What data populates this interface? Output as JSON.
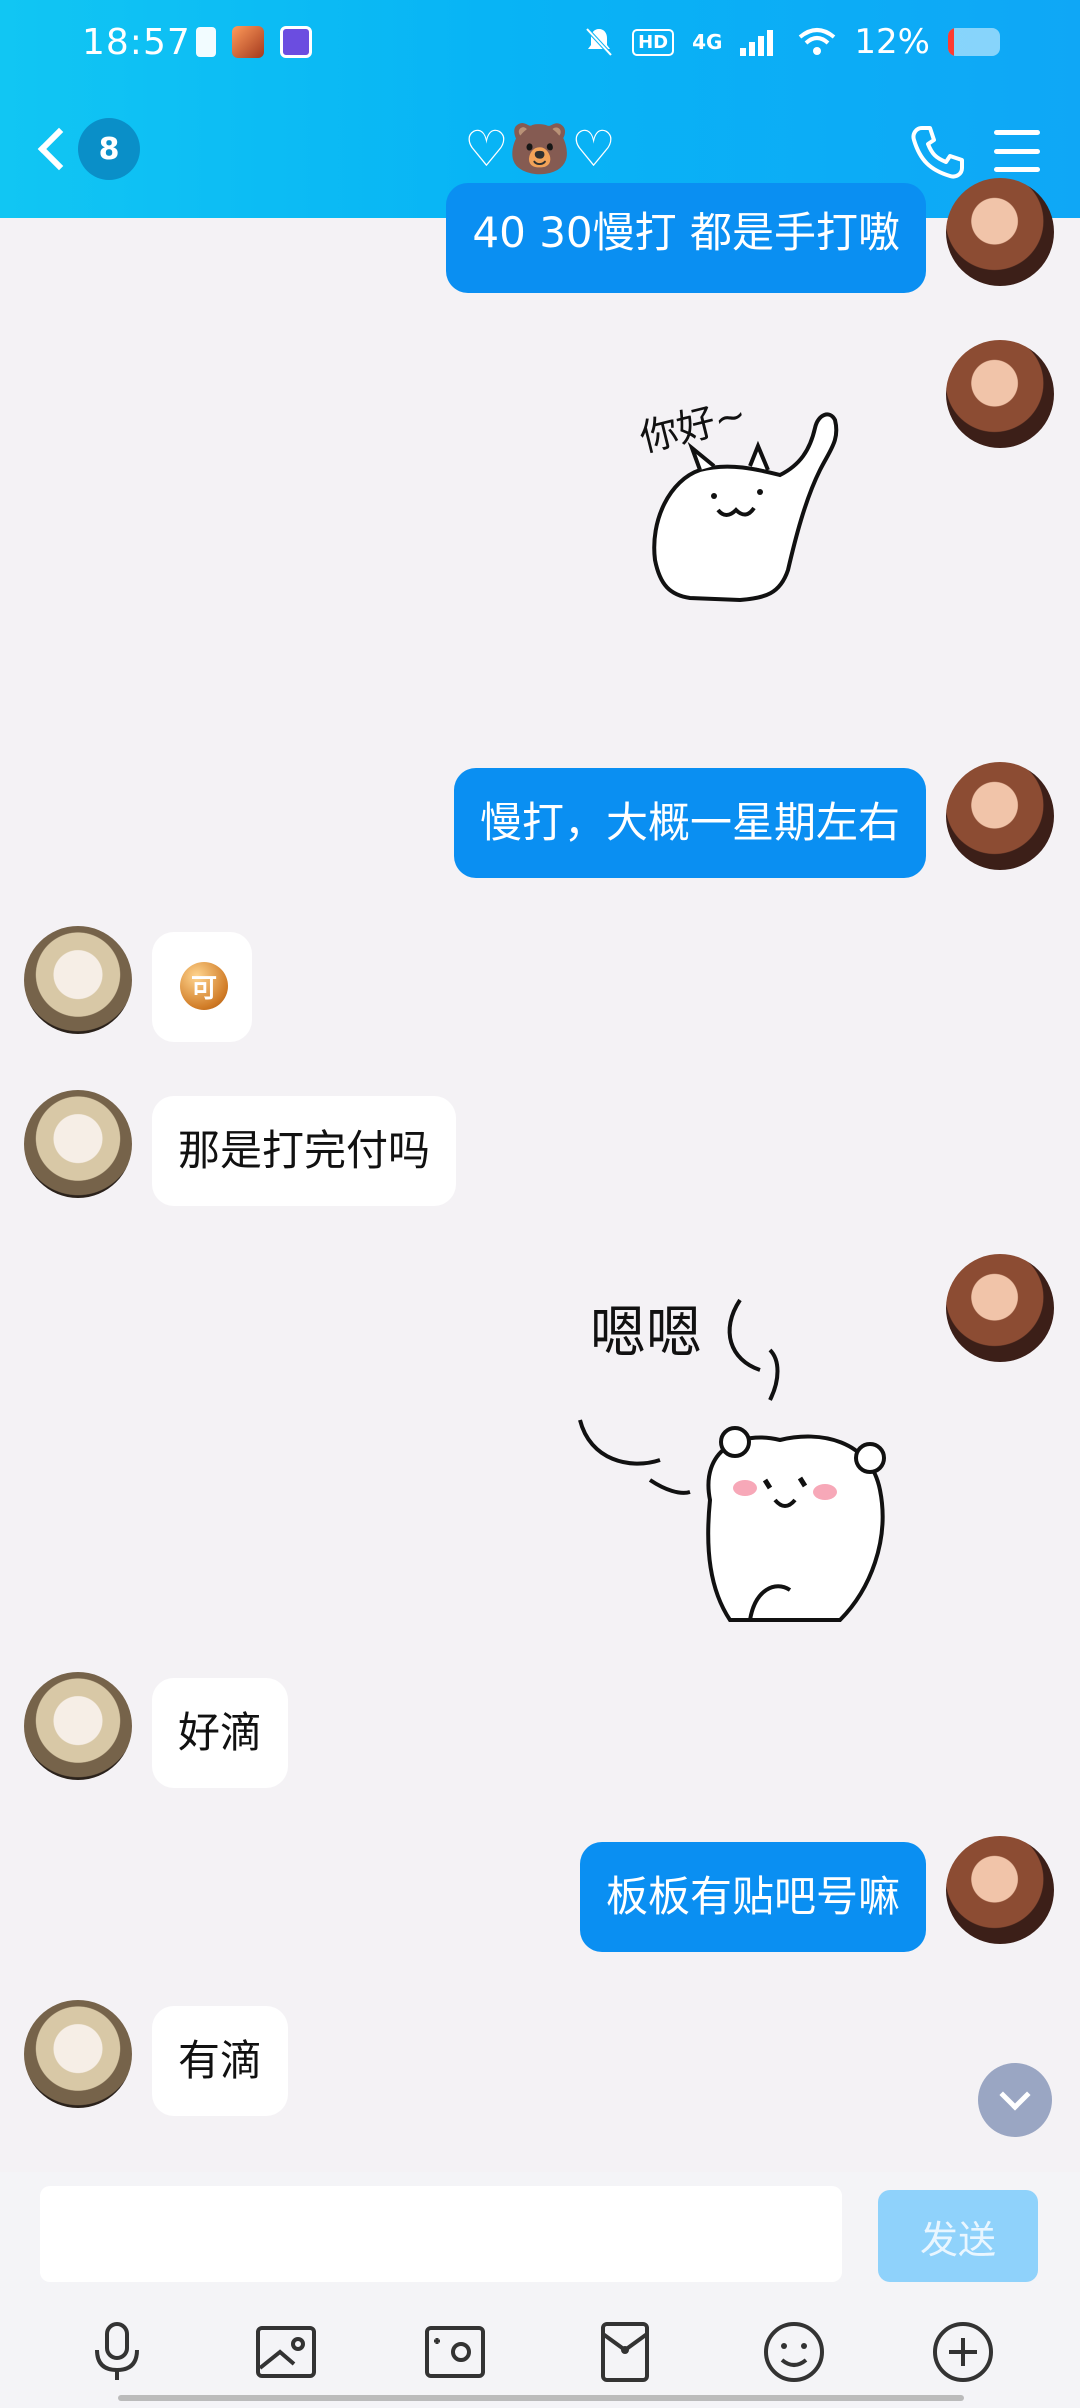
{
  "status_bar": {
    "time": "18:57",
    "network": "4G",
    "battery": "12%"
  },
  "header": {
    "unread_count": "8",
    "title": "♡🐻♡"
  },
  "messages": [
    {
      "from": "me",
      "type": "text",
      "text": "40 30慢打 都是手打嗷"
    },
    {
      "from": "me",
      "type": "sticker",
      "text": "你好~"
    },
    {
      "from": "me",
      "type": "text",
      "text": "慢打，大概一星期左右"
    },
    {
      "from": "them",
      "type": "emoji",
      "text": "可"
    },
    {
      "from": "them",
      "type": "text",
      "text": "那是打完付吗"
    },
    {
      "from": "me",
      "type": "sticker",
      "text": "嗯嗯"
    },
    {
      "from": "them",
      "type": "text",
      "text": "好滴"
    },
    {
      "from": "me",
      "type": "text",
      "text": "板板有贴吧号嘛"
    },
    {
      "from": "them",
      "type": "text",
      "text": "有滴"
    }
  ],
  "composer": {
    "placeholder": "",
    "send_label": "发送"
  },
  "toolbar_icons": [
    "microphone-icon",
    "image-icon",
    "camera-icon",
    "red-packet-icon",
    "emoji-icon",
    "plus-icon"
  ],
  "colors": {
    "header": "#0fb1f5",
    "outgoing_bubble": "#0a8ff2",
    "incoming_bubble": "#ffffff",
    "send_button": "#8fd2fb"
  }
}
